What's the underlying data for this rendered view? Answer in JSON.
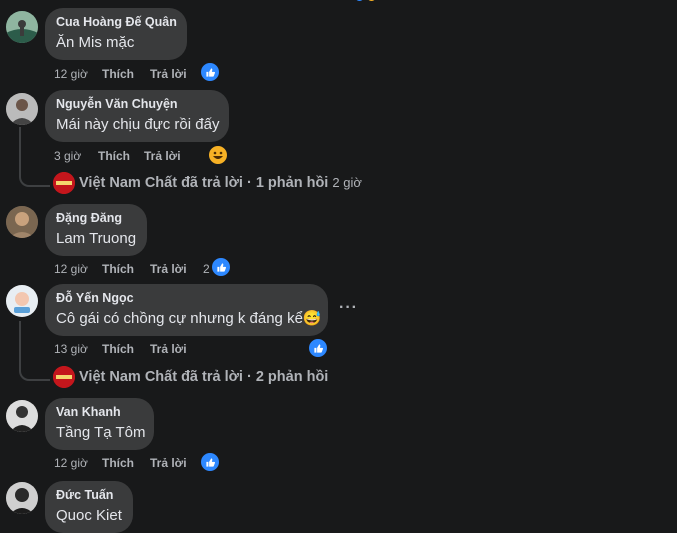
{
  "comments": [
    {
      "author": "Cua Hoàng Đế Quân",
      "text": "Ăn Mis mặc",
      "time": "12 giờ",
      "like": "Thích",
      "reply": "Trả lời",
      "reaction_count": ""
    },
    {
      "author": "Nguyễn Văn Chuyện",
      "text": "Mái này chịu đực rồi đấy",
      "time": "3 giờ",
      "like": "Thích",
      "reply": "Trả lời",
      "reaction_count": ""
    },
    {
      "author": "Đặng Đăng",
      "text": "Lam Truong",
      "time": "12 giờ",
      "like": "Thích",
      "reply": "Trả lời",
      "reaction_count": "2"
    },
    {
      "author": "Đỗ Yến Ngọc",
      "text": "Cô gái có chồng cự nhưng k đáng kể😅",
      "time": "13 giờ",
      "like": "Thích",
      "reply": "Trả lời",
      "reaction_count": ""
    },
    {
      "author": "Van Khanh",
      "text": "Tầng Tạ Tôm",
      "time": "12 giờ",
      "like": "Thích",
      "reply": "Trả lời",
      "reaction_count": ""
    },
    {
      "author": "Đức Tuấn",
      "text": "Quoc Kiet",
      "time": "",
      "like": "",
      "reply": "",
      "reaction_count": ""
    }
  ],
  "replies": [
    {
      "page": "Việt Nam Chất",
      "label": "Việt Nam Chất đã trả lời · 1 phản hồi",
      "time": "2 giờ"
    },
    {
      "page": "Việt Nam Chất",
      "label": "Việt Nam Chất đã trả lời · 2 phản hồi",
      "time": ""
    }
  ],
  "more_options": "···",
  "colors": {
    "background": "#18191a",
    "bubble": "#3a3b3c",
    "like_blue": "#2d88ff",
    "haha_yellow": "#f7b125",
    "page_red": "#c4161c"
  }
}
